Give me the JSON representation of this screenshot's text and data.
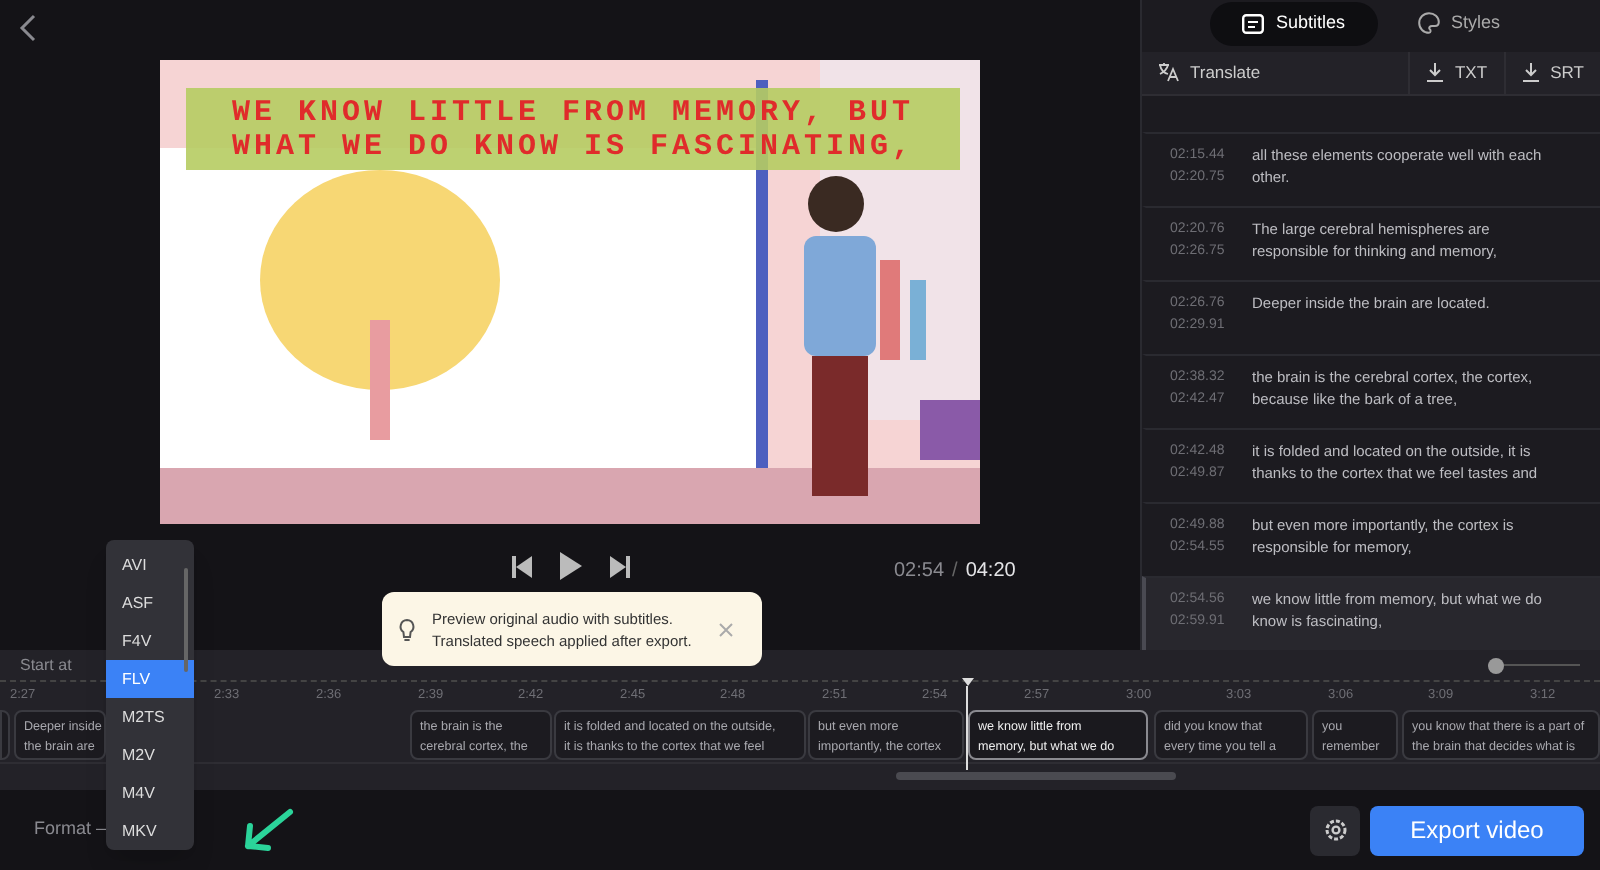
{
  "video": {
    "subtitle_lines": [
      "WE KNOW LITTLE FROM MEMORY, BUT",
      "WHAT WE DO KNOW IS FASCINATING,"
    ],
    "current_time": "02:54",
    "separator": "/",
    "duration": "04:20"
  },
  "tooltip": {
    "text": "Preview original audio with subtitles. Translated speech applied after export."
  },
  "panel": {
    "tabs": [
      {
        "label": "Subtitles",
        "selected": true
      },
      {
        "label": "Styles",
        "selected": false
      }
    ],
    "actions": [
      {
        "label": "Translate",
        "kind": "translate"
      },
      {
        "label": "TXT",
        "kind": "download"
      },
      {
        "label": "SRT",
        "kind": "download"
      }
    ],
    "subtitles": [
      {
        "start": "02:15.44",
        "end": "02:20.75",
        "text": "all these elements cooperate well with each other.",
        "selected": false
      },
      {
        "start": "02:20.76",
        "end": "02:26.75",
        "text": "The large cerebral hemispheres are responsible for thinking and memory,",
        "selected": false
      },
      {
        "start": "02:26.76",
        "end": "02:29.91",
        "text": "Deeper inside the brain are located.",
        "selected": false
      },
      {
        "start": "02:38.32",
        "end": "02:42.47",
        "text": "the brain is the cerebral cortex, the cortex, because like the bark of a tree,",
        "selected": false
      },
      {
        "start": "02:42.48",
        "end": "02:49.87",
        "text": "it is folded and located on the outside, it is thanks to the cortex that we feel tastes and",
        "selected": false
      },
      {
        "start": "02:49.88",
        "end": "02:54.55",
        "text": "but even more importantly, the cortex is responsible for memory,",
        "selected": false
      },
      {
        "start": "02:54.56",
        "end": "02:59.91",
        "text": "we know little from memory, but what we do know is fascinating,",
        "selected": true
      }
    ]
  },
  "timeline": {
    "start_label": "Start at",
    "zoom_slider": {
      "level": 0
    },
    "ticks": [
      "2:27",
      "2:33",
      "2:36",
      "2:39",
      "2:42",
      "2:45",
      "2:48",
      "2:51",
      "2:54",
      "2:57",
      "3:00",
      "3:03",
      "3:06",
      "3:09",
      "3:12"
    ],
    "clips": [
      {
        "lines": [
          "Deeper inside",
          "the brain are"
        ],
        "selected": false
      },
      {
        "lines": [
          "the brain is the",
          "cerebral cortex, the"
        ],
        "selected": false
      },
      {
        "lines": [
          "it is folded and located on the outside,",
          "it is thanks to the cortex that we feel"
        ],
        "selected": false
      },
      {
        "lines": [
          "but even more",
          "importantly, the cortex"
        ],
        "selected": false
      },
      {
        "lines": [
          "we know little from",
          "memory, but what we do"
        ],
        "selected": true
      },
      {
        "lines": [
          "did you know that",
          "every time you tell a"
        ],
        "selected": false
      },
      {
        "lines": [
          "you",
          "remember"
        ],
        "selected": false
      },
      {
        "lines": [
          "you know that there is a part of",
          "the brain that decides what is"
        ],
        "selected": false
      }
    ]
  },
  "format": {
    "label": "Format —",
    "options": [
      {
        "label": "AVI",
        "selected": false
      },
      {
        "label": "ASF",
        "selected": false
      },
      {
        "label": "F4V",
        "selected": false
      },
      {
        "label": "FLV",
        "selected": true
      },
      {
        "label": "M2TS",
        "selected": false
      },
      {
        "label": "M2V",
        "selected": false
      },
      {
        "label": "M4V",
        "selected": false
      },
      {
        "label": "MKV",
        "selected": false
      }
    ]
  },
  "export_button": "Export video"
}
